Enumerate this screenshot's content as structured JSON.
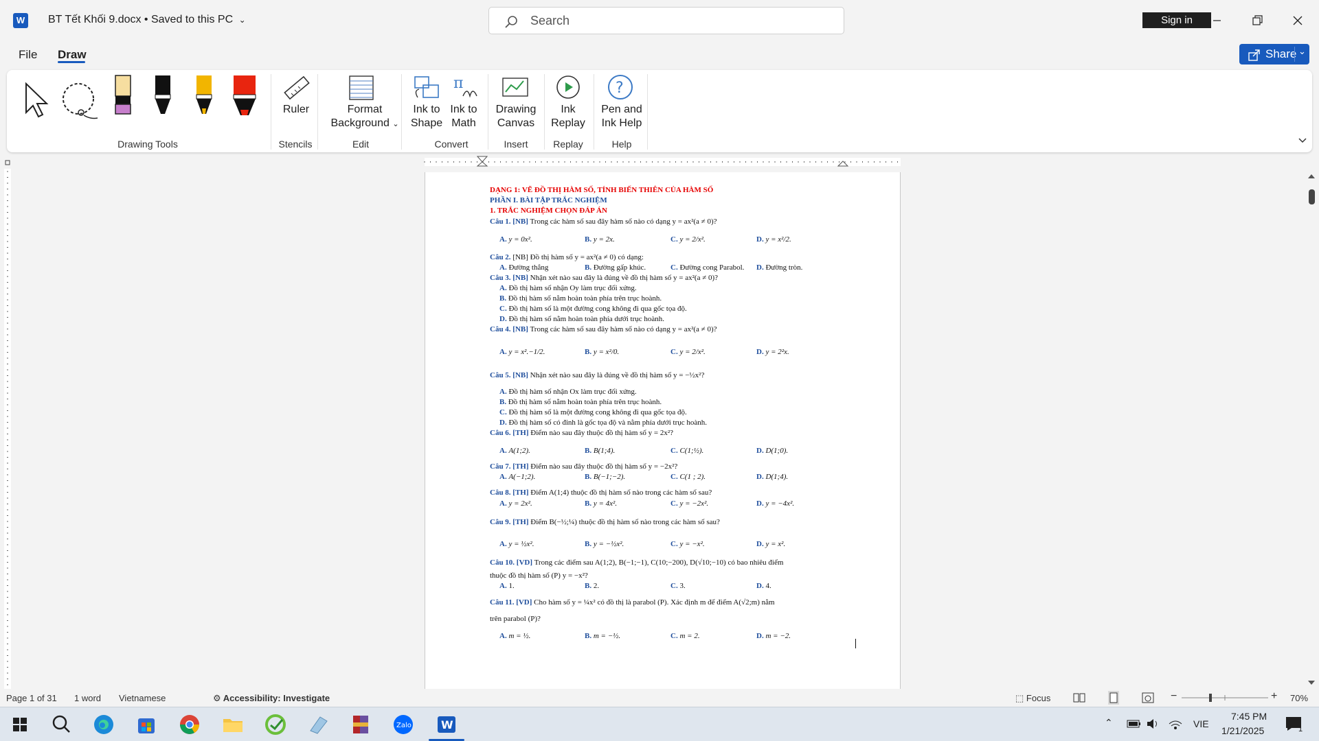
{
  "app": {
    "title": "BT Tết Khối 9.docx • Saved to this PC",
    "search_placeholder": "Search",
    "sign_in": "Sign in",
    "share": "Share",
    "brand_color": "#185abd"
  },
  "tabs": [
    {
      "label": "File"
    },
    {
      "label": "Draw"
    }
  ],
  "ribbon": {
    "items": {
      "ruler": "Ruler",
      "format_bg_1": "Format",
      "format_bg_2": "Background",
      "ink_shape_1": "Ink to",
      "ink_shape_2": "Shape",
      "ink_math_1": "Ink to",
      "ink_math_2": "Math",
      "canvas_1": "Drawing",
      "canvas_2": "Canvas",
      "replay_1": "Ink",
      "replay_2": "Replay",
      "help_1": "Pen and",
      "help_2": "Ink Help"
    },
    "groups": {
      "drawing_tools": "Drawing Tools",
      "stencils": "Stencils",
      "edit": "Edit",
      "convert": "Convert",
      "insert": "Insert",
      "replay": "Replay",
      "help": "Help"
    }
  },
  "document": {
    "h1": "DẠNG 1: VẼ ĐỒ THỊ HÀM SỐ, TÍNH BIẾN THIÊN CỦA HÀM SỐ",
    "h2": "PHẦN I. BÀI TẬP TRẮC NGHIỆM",
    "h3": "1. TRẮC NGHIỆM CHỌN ĐÁP ÁN",
    "q1": {
      "lbl": "Câu 1. [NB]",
      "text": " Trong các hàm số sau đây hàm số nào có dạng y = ax²(a ≠ 0)?",
      "a": "y = 0x².",
      "b": "y = 2x.",
      "c": "y = 2/x².",
      "d": "y = x²/2."
    },
    "q2": {
      "lbl": "Câu 2.",
      "text": " [NB] Đồ thị hàm số y = ax²(a ≠ 0) có dạng:",
      "a": "Đường thẳng",
      "b": "Đường gấp khúc.",
      "c": "Đường cong Parabol.",
      "d": "Đường tròn."
    },
    "q3": {
      "lbl": "Câu 3. [NB]",
      "text": " Nhận xét nào sau đây là đúng về đồ thị hàm số y = ax²(a ≠ 0)?",
      "a": "Đồ thị hàm số nhận Oy làm trục đối xứng.",
      "b": "Đồ thị hàm số nằm hoàn toàn phía trên trục hoành.",
      "c": "Đồ thị hàm số là một đường cong không đi qua gốc tọa độ.",
      "d": "Đồ thị hàm số nằm hoàn toàn phía dưới trục hoành."
    },
    "q4": {
      "lbl": "Câu 4. [NB]",
      "text": " Trong các hàm số sau đây hàm số nào có dạng y = ax²(a ≠ 0)?",
      "a": "y = x².−1/2.",
      "b": "y = x²/0.",
      "c": "y = 2/x².",
      "d": "y = 2²x."
    },
    "q5": {
      "lbl": "Câu 5. [NB]",
      "text": " Nhận xét nào sau đây là đúng về đồ thị hàm số y = −½x²?",
      "a": "Đồ thị hàm số nhận Ox làm trục đối xứng.",
      "b": "Đồ thị hàm số nằm hoàn toàn phía trên trục hoành.",
      "c": "Đồ thị hàm số là một đường cong không đi qua gốc tọa độ.",
      "d": "Đồ thị hàm số có đỉnh là gốc tọa độ và nằm phía dưới trục hoành."
    },
    "q6": {
      "lbl": "Câu 6. [TH]",
      "text": " Điểm nào sau đây thuộc đồ thị hàm số y = 2x²?",
      "a": "A(1;2).",
      "b": "B(1;4).",
      "c": "C(1;½).",
      "d": "D(1;0)."
    },
    "q7": {
      "lbl": "Câu 7. [TH]",
      "text": " Điểm nào sau đây thuộc đồ thị hàm số y = −2x²?",
      "a": "A(−1;2).",
      "b": "B(−1;−2).",
      "c": "C(1 ; 2).",
      "d": "D(1;4)."
    },
    "q8": {
      "lbl": "Câu 8. [TH]",
      "text": " Điểm A(1;4) thuộc đồ thị hàm số nào trong các hàm số sau?",
      "a": "y = 2x².",
      "b": "y = 4x².",
      "c": "y = −2x².",
      "d": "y = −4x²."
    },
    "q9": {
      "lbl": "Câu 9. [TH]",
      "text": " Điểm B(−½;¼) thuộc đồ thị hàm số nào trong các hàm số sau?",
      "a": "y = ½x².",
      "b": "y = −½x².",
      "c": "y = −x².",
      "d": "y = x²."
    },
    "q10": {
      "lbl": "Câu 10. [VD]",
      "text": " Trong các điểm sau A(1;2), B(−1;−1), C(10;−200), D(√10;−10) có bao nhiêu điểm",
      "text2": "thuộc đồ thị hàm số (P) y = −x²?",
      "a": "1.",
      "b": "2.",
      "c": "3.",
      "d": "4."
    },
    "q11": {
      "lbl": "Câu 11. [VD]",
      "text": " Cho hàm số y = ¼x² có đồ thị là parabol (P). Xác định m để điểm A(√2;m) nằm",
      "text2": "trên parabol (P)?",
      "a": "m = ½.",
      "b": "m = −½.",
      "c": "m = 2.",
      "d": "m = −2."
    },
    "opt_a": "A.",
    "opt_b": "B.",
    "opt_c": "C.",
    "opt_d": "D."
  },
  "status": {
    "page": "Page 1 of 31",
    "words": "1 word",
    "language": "Vietnamese",
    "accessibility": "Accessibility: Investigate",
    "focus": "Focus",
    "zoom": "70%"
  },
  "tray": {
    "lang": "VIE",
    "time": "7:45 PM",
    "date": "1/21/2025",
    "notifications": "1"
  }
}
